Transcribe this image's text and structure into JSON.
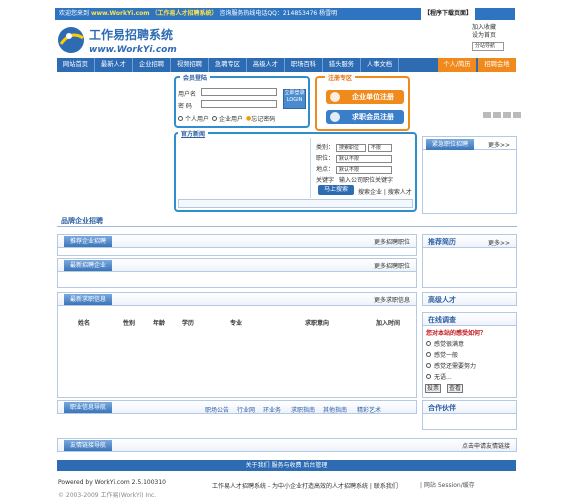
{
  "topbar": {
    "greeting": "欢迎您来到",
    "site_url": "www.WorkYi.com",
    "tagline": "（工作易人才招聘系统）",
    "hotline": "咨询服务热线电话QQ：214853476 杨雪明",
    "download": "【程序下载页面】"
  },
  "logo": {
    "title": "工作易招聘系统",
    "url": "www.WorkYi.com"
  },
  "top_links": {
    "favorite": "加入收藏",
    "homepage": "设为首页",
    "select_value": "分站导航"
  },
  "nav": {
    "items": [
      "网站首页",
      "最新人才",
      "企业招聘",
      "视频招聘",
      "急聘专区",
      "高级人才",
      "职场百科",
      "猎头服务",
      "人事文档"
    ],
    "orange_items": [
      "个人/简历",
      "招聘会地"
    ]
  },
  "login": {
    "title": "会员登陆",
    "username_label": "用户名",
    "password_label": "密   码",
    "button": "立即登录",
    "button_sub": "LOGIN",
    "radio_personal": "个人用户",
    "radio_company": "企业用户",
    "forgot": "忘记密码"
  },
  "register": {
    "title": "注册专区",
    "company_button": "企业单位注册",
    "person_button": "求职会员注册"
  },
  "announce": {
    "title": "官方新闻"
  },
  "search": {
    "type_label": "类别：",
    "type_value": "搜索职位",
    "type_value2": "不限",
    "job_label": "职位：",
    "job_value": "默认不限",
    "area_label": "地点：",
    "area_value": "默认不限",
    "keyword_label": "关键字",
    "keyword_placeholder": "输入公司职位关键字",
    "button": "马上搜索",
    "link_company": "搜索企业",
    "link_person": "搜索人才"
  },
  "right": {
    "urgent_title": "紧急职位招聘",
    "more": "更多>>",
    "resume_title": "推荐简历",
    "talent_title": "高级人才",
    "online_survey": "在线调查",
    "partners": "合作伙伴"
  },
  "brand_section": {
    "title": "品牌企业招聘"
  },
  "sections": {
    "recommend": {
      "title": "推荐企业招聘",
      "more": "更多招聘职位"
    },
    "latest": {
      "title": "最新招聘企业",
      "more": "更多招聘职位"
    },
    "jobs": {
      "title": "最新求职信息",
      "more": "更多求职信息"
    },
    "guide": {
      "title": "职业信息导航"
    },
    "links": {
      "title": "友情链接导航",
      "more": "点击申请友情链接"
    }
  },
  "table": {
    "headers": [
      "姓名",
      "性别",
      "年龄",
      "学历",
      "专业",
      "求职意向",
      "加入时间"
    ]
  },
  "poll": {
    "question": "您对本站的感受如何？",
    "options": [
      "感觉很满意",
      "感觉一般",
      "感觉还需要努力",
      "无语..."
    ],
    "vote": "投票",
    "view": "查看"
  },
  "guide_links": [
    "职场公告",
    "行业网",
    "环业务",
    "求职指南",
    "其他指南",
    "精彩艺术"
  ],
  "footer": {
    "links": "关于我们  服务与收费  后台管理",
    "powered": "Powered by WorkYi.com 2.5.100310",
    "copyright": "© 2003-2009 工作易(WorkYi) Inc.",
    "desc": "工作易人才招聘系统 - 为中小企业打造高效的人才招聘系统 | 联系我们",
    "status": "| 网站 Session/缓存"
  },
  "colors": {
    "primary": "#2d6bb3",
    "accent": "#f08a1c",
    "border": "#2d8fce"
  }
}
